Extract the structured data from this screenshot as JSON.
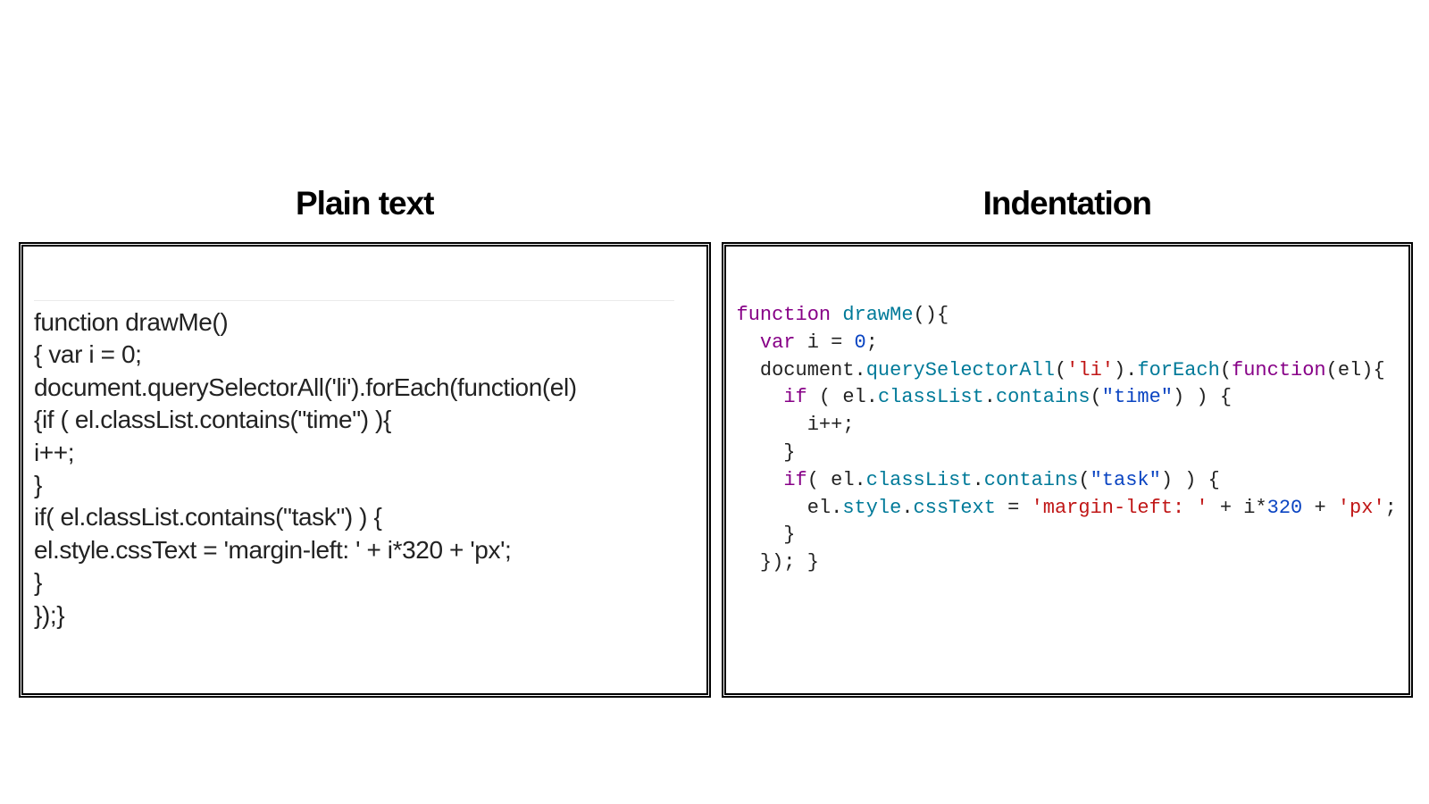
{
  "headings": {
    "left": "Plain text",
    "right": "Indentation"
  },
  "plain_code": "function drawMe()\n{ var i = 0;\ndocument.querySelectorAll('li').forEach(function(el)\n{if ( el.classList.contains(\"time\") ){\ni++;\n}\nif( el.classList.contains(\"task\") ) {\nel.style.cssText = 'margin-left: ' + i*320 + 'px';\n}\n});}",
  "indented_tokens": [
    [
      {
        "t": "function",
        "c": "kw"
      },
      {
        "t": " "
      },
      {
        "t": "drawMe",
        "c": "fn"
      },
      {
        "t": "(){"
      }
    ],
    [
      {
        "t": "  "
      },
      {
        "t": "var",
        "c": "kw"
      },
      {
        "t": " i = "
      },
      {
        "t": "0",
        "c": "num"
      },
      {
        "t": ";"
      }
    ],
    [
      {
        "t": "  document."
      },
      {
        "t": "querySelectorAll",
        "c": "fn"
      },
      {
        "t": "("
      },
      {
        "t": "'li'",
        "c": "str1"
      },
      {
        "t": ")."
      },
      {
        "t": "forEach",
        "c": "fn"
      },
      {
        "t": "("
      },
      {
        "t": "function",
        "c": "kw"
      },
      {
        "t": "(el){"
      }
    ],
    [
      {
        "t": "    "
      },
      {
        "t": "if",
        "c": "kw"
      },
      {
        "t": " ( el."
      },
      {
        "t": "classList",
        "c": "fn"
      },
      {
        "t": "."
      },
      {
        "t": "contains",
        "c": "fn"
      },
      {
        "t": "("
      },
      {
        "t": "\"time\"",
        "c": "str2"
      },
      {
        "t": ") ) {"
      }
    ],
    [
      {
        "t": "      i++;"
      }
    ],
    [
      {
        "t": "    }"
      }
    ],
    [
      {
        "t": "    "
      },
      {
        "t": "if",
        "c": "kw"
      },
      {
        "t": "( el."
      },
      {
        "t": "classList",
        "c": "fn"
      },
      {
        "t": "."
      },
      {
        "t": "contains",
        "c": "fn"
      },
      {
        "t": "("
      },
      {
        "t": "\"task\"",
        "c": "str2"
      },
      {
        "t": ") ) {"
      }
    ],
    [
      {
        "t": "      el."
      },
      {
        "t": "style",
        "c": "fn"
      },
      {
        "t": "."
      },
      {
        "t": "cssText",
        "c": "fn"
      },
      {
        "t": " = "
      },
      {
        "t": "'margin-left: '",
        "c": "str1"
      },
      {
        "t": " + i*"
      },
      {
        "t": "320",
        "c": "num"
      },
      {
        "t": " + "
      },
      {
        "t": "'px'",
        "c": "str1"
      },
      {
        "t": ";"
      }
    ],
    [
      {
        "t": "    }"
      }
    ],
    [
      {
        "t": "  }); }"
      }
    ]
  ]
}
